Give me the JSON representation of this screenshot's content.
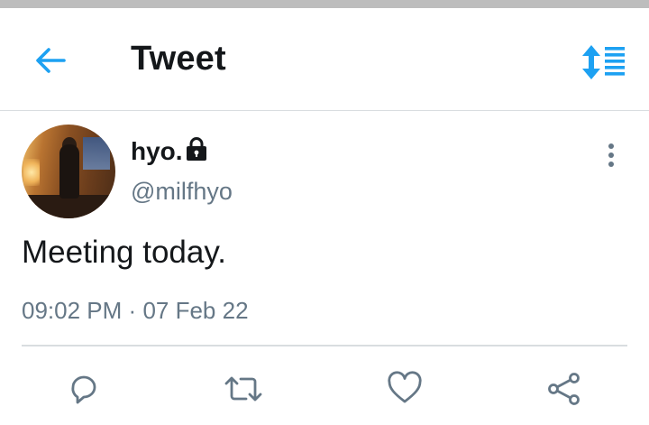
{
  "header": {
    "title": "Tweet",
    "back_icon": "arrow-left-icon",
    "sort_icon": "sort-list-icon",
    "accent_color": "#1da1f2"
  },
  "tweet": {
    "display_name": "hyo.",
    "protected_icon": "lock-icon",
    "handle": "@milfhyo",
    "text": "Meeting today.",
    "time": "09:02 PM",
    "separator": "·",
    "date": "07 Feb 22",
    "more_icon": "more-vertical-icon"
  },
  "actions": [
    {
      "icon": "reply-icon"
    },
    {
      "icon": "retweet-icon"
    },
    {
      "icon": "like-icon"
    },
    {
      "icon": "share-icon"
    }
  ],
  "colors": {
    "text_primary": "#14171a",
    "text_secondary": "#657786",
    "divider": "#d9dde0"
  }
}
